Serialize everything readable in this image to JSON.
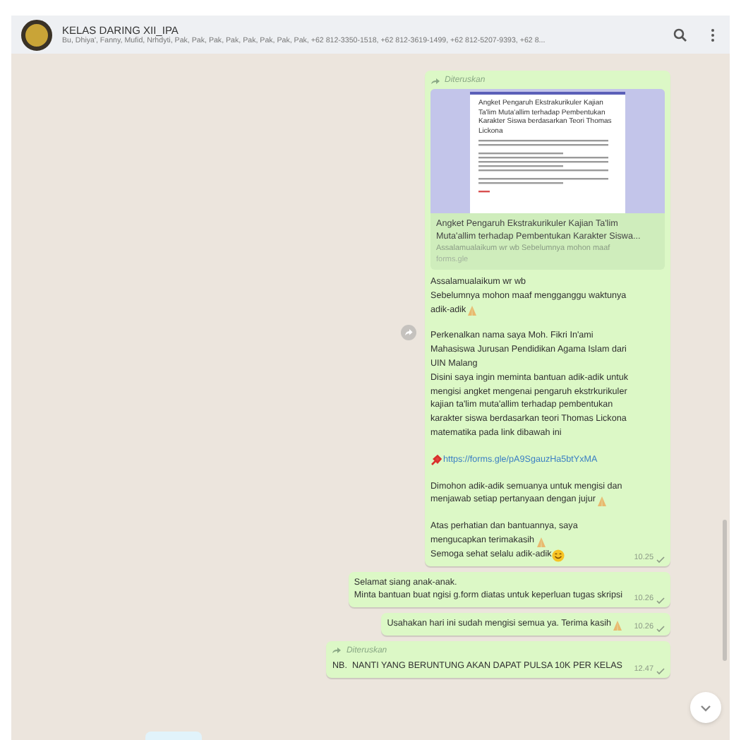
{
  "header": {
    "title": "KELAS DARING XII_IPA",
    "participants": "Bu, Dhiya', Fanny, Mufid, Nrhdyti, Pak, Pak, Pak, Pak, Pak, Pak, Pak, Pak, +62 812-3350-1518, +62 812-3619-1499, +62 812-5207-9393, +62 8..."
  },
  "messages": [
    {
      "kind": "link",
      "forwarded": true,
      "forwarded_label": "Diteruskan",
      "preview": {
        "doc_title": "Angket Pengaruh Ekstrakurikuler Kajian Ta'lim Muta'allim terhadap Pembentukan Karakter Siswa berdasarkan Teori Thomas Lickona",
        "title": "Angket Pengaruh Ekstrakurikuler Kajian Ta'lim Muta'allim terhadap Pembentukan Karakter Siswa...",
        "description": "Assalamualaikum wr wb Sebelumnya mohon maaf",
        "domain": "forms.gle"
      },
      "blocks": [
        [
          {
            "text": "Assalamualaikum wr wb\nSebelumnya mohon maaf mengganggu waktunya"
          },
          {
            "text": "adik-adik",
            "praying_hands": true
          }
        ],
        [
          {
            "text": "Perkenalkan nama saya Moh. Fikri In'ami\nMahasiswa Jurusan Pendidikan Agama Islam dari\nUIN Malang\nDisini saya ingin meminta bantuan adik-adik untuk\nmengisi angket mengenai pengaruh ekstrkurikuler\nkajian ta'lim muta'allim terhadap pembentukan\nkarakter siswa berdasarkan teori Thomas Lickona\nmatematika pada link dibawah ini"
          }
        ],
        [
          {
            "text": "https://forms.gle/pA9SgauzHa5btYxMA",
            "kind": "link",
            "pin": true
          }
        ],
        [
          {
            "text": "Dimohon adik-adik semuanya untuk mengisi dan"
          },
          {
            "text": "menjawab setiap pertanyaan dengan jujur",
            "praying_hands": true
          }
        ],
        [
          {
            "text": "Atas perhatian dan bantuannya, saya"
          },
          {
            "text": "mengucapkan terimakasih",
            "praying_hands": true
          },
          {
            "text": "Semoga sehat selalu adik-adik",
            "smiley": true
          }
        ]
      ],
      "time": "10.25"
    },
    {
      "kind": "text",
      "forwarded": false,
      "blocks": [
        [
          {
            "text": "Selamat siang anak-anak.\nMinta bantuan buat ngisi g.form diatas untuk keperluan tugas skripsi"
          }
        ]
      ],
      "time": "10.26"
    },
    {
      "kind": "text",
      "forwarded": false,
      "blocks": [
        [
          {
            "text": "Usahakan hari ini sudah mengisi semua ya. Terima kasih",
            "praying_hands": true
          }
        ]
      ],
      "time": "10.26"
    },
    {
      "kind": "text",
      "forwarded": true,
      "forwarded_label": "Diteruskan",
      "blocks": [
        [
          {
            "text": "NB.  NANTI YANG BERUNTUNG AKAN DAPAT PULSA 10K PER KELAS"
          }
        ]
      ],
      "time": "12.47"
    }
  ]
}
